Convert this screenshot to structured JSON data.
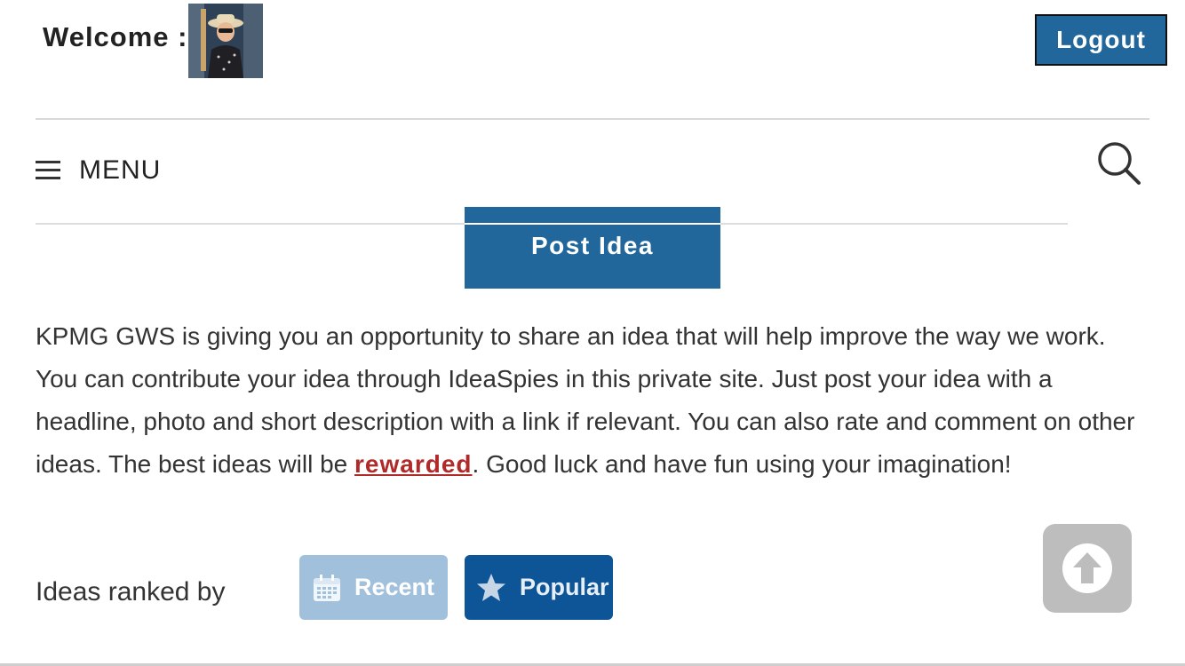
{
  "header": {
    "welcome_label": "Welcome :",
    "logout_label": "Logout"
  },
  "nav": {
    "menu_label": "MENU",
    "menu_icon": "hamburger-icon",
    "search_icon": "search-icon"
  },
  "post_idea": {
    "label": "Post Idea"
  },
  "intro": {
    "text_before_link": "KPMG GWS is giving you an opportunity to share an idea that will help improve the way we work. You can contribute your idea through IdeaSpies in this private site. Just post your idea with a headline, photo and short description with a link if relevant. You can also rate and comment on other ideas. The best ideas will be ",
    "link_text": "rewarded",
    "text_after_link": ". Good luck and have fun using your imagination!"
  },
  "ranking": {
    "label": "Ideas ranked by",
    "options": [
      {
        "label": "Recent",
        "icon": "calendar-icon",
        "selected": false
      },
      {
        "label": "Popular",
        "icon": "star-icon",
        "selected": true
      }
    ]
  },
  "colors": {
    "primary_blue": "#21679b",
    "link_red": "#b02a2a",
    "recent_bg": "#a1c0dc",
    "popular_bg": "#0d5597",
    "back_to_top_bg": "#bdbdbd"
  }
}
